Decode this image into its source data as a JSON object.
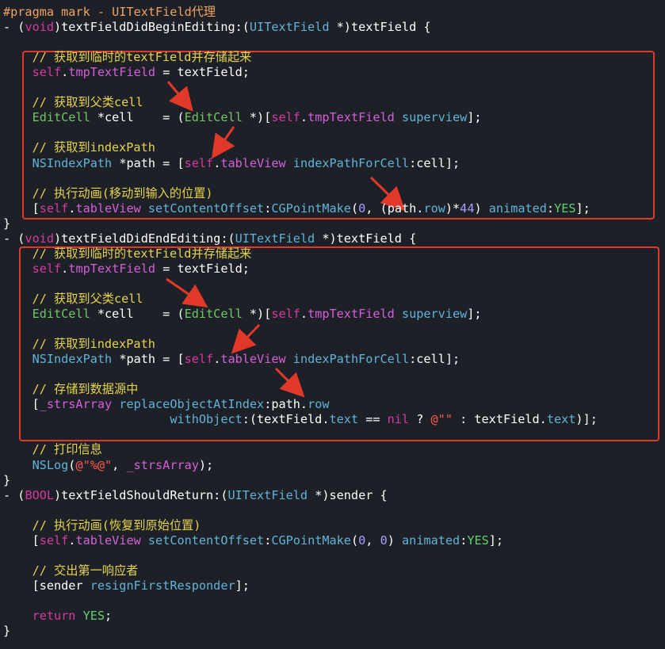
{
  "code_lines": [
    [
      {
        "t": "#pragma mark - UITextField代理",
        "c": "pragma"
      }
    ],
    [
      {
        "t": "- (",
        "c": "plain"
      },
      {
        "t": "void",
        "c": "kw"
      },
      {
        "t": ")textFieldDidBeginEditing:(",
        "c": "plain"
      },
      {
        "t": "UITextField",
        "c": "type"
      },
      {
        "t": " *)textField {",
        "c": "plain"
      }
    ],
    [],
    [
      {
        "t": "    // 获取到临时的textField并存储起来",
        "c": "comment"
      }
    ],
    [
      {
        "t": "    ",
        "c": "plain"
      },
      {
        "t": "self",
        "c": "self"
      },
      {
        "t": ".",
        "c": "plain"
      },
      {
        "t": "tmpTextField",
        "c": "prop"
      },
      {
        "t": " = textField;",
        "c": "plain"
      }
    ],
    [],
    [
      {
        "t": "    // 获取到父类cell",
        "c": "comment"
      }
    ],
    [
      {
        "t": "    ",
        "c": "plain"
      },
      {
        "t": "EditCell",
        "c": "class"
      },
      {
        "t": " *cell    = (",
        "c": "plain"
      },
      {
        "t": "EditCell",
        "c": "class"
      },
      {
        "t": " *)[",
        "c": "plain"
      },
      {
        "t": "self",
        "c": "self"
      },
      {
        "t": ".",
        "c": "plain"
      },
      {
        "t": "tmpTextField",
        "c": "prop"
      },
      {
        "t": " ",
        "c": "plain"
      },
      {
        "t": "superview",
        "c": "method"
      },
      {
        "t": "];",
        "c": "plain"
      }
    ],
    [],
    [
      {
        "t": "    // 获取到indexPath",
        "c": "comment"
      }
    ],
    [
      {
        "t": "    ",
        "c": "plain"
      },
      {
        "t": "NSIndexPath",
        "c": "type"
      },
      {
        "t": " *path = [",
        "c": "plain"
      },
      {
        "t": "self",
        "c": "self"
      },
      {
        "t": ".",
        "c": "plain"
      },
      {
        "t": "tableView",
        "c": "prop"
      },
      {
        "t": " ",
        "c": "plain"
      },
      {
        "t": "indexPathForCell",
        "c": "method"
      },
      {
        "t": ":cell];",
        "c": "plain"
      }
    ],
    [],
    [
      {
        "t": "    // 执行动画(移动到输入的位置)",
        "c": "comment"
      }
    ],
    [
      {
        "t": "    [",
        "c": "plain"
      },
      {
        "t": "self",
        "c": "self"
      },
      {
        "t": ".",
        "c": "plain"
      },
      {
        "t": "tableView",
        "c": "prop"
      },
      {
        "t": " ",
        "c": "plain"
      },
      {
        "t": "setContentOffset",
        "c": "method"
      },
      {
        "t": ":",
        "c": "plain"
      },
      {
        "t": "CGPointMake",
        "c": "method"
      },
      {
        "t": "(",
        "c": "plain"
      },
      {
        "t": "0",
        "c": "num"
      },
      {
        "t": ", (path.",
        "c": "plain"
      },
      {
        "t": "row",
        "c": "method"
      },
      {
        "t": ")*",
        "c": "plain"
      },
      {
        "t": "44",
        "c": "num"
      },
      {
        "t": ") ",
        "c": "plain"
      },
      {
        "t": "animated",
        "c": "method"
      },
      {
        "t": ":",
        "c": "plain"
      },
      {
        "t": "YES",
        "c": "kwg"
      },
      {
        "t": "];",
        "c": "plain"
      }
    ],
    [
      {
        "t": "}",
        "c": "plain"
      }
    ],
    [
      {
        "t": "- (",
        "c": "plain"
      },
      {
        "t": "void",
        "c": "kw"
      },
      {
        "t": ")textFieldDidEndEditing:(",
        "c": "plain"
      },
      {
        "t": "UITextField",
        "c": "type"
      },
      {
        "t": " *)textField {",
        "c": "plain"
      }
    ],
    [
      {
        "t": "    // 获取到临时的textField并存储起来",
        "c": "comment"
      }
    ],
    [
      {
        "t": "    ",
        "c": "plain"
      },
      {
        "t": "self",
        "c": "self"
      },
      {
        "t": ".",
        "c": "plain"
      },
      {
        "t": "tmpTextField",
        "c": "prop"
      },
      {
        "t": " = textField;",
        "c": "plain"
      }
    ],
    [],
    [
      {
        "t": "    // 获取到父类cell",
        "c": "comment"
      }
    ],
    [
      {
        "t": "    ",
        "c": "plain"
      },
      {
        "t": "EditCell",
        "c": "class"
      },
      {
        "t": " *cell    = (",
        "c": "plain"
      },
      {
        "t": "EditCell",
        "c": "class"
      },
      {
        "t": " *)[",
        "c": "plain"
      },
      {
        "t": "self",
        "c": "self"
      },
      {
        "t": ".",
        "c": "plain"
      },
      {
        "t": "tmpTextField",
        "c": "prop"
      },
      {
        "t": " ",
        "c": "plain"
      },
      {
        "t": "superview",
        "c": "method"
      },
      {
        "t": "];",
        "c": "plain"
      }
    ],
    [],
    [
      {
        "t": "    // 获取到indexPath",
        "c": "comment"
      }
    ],
    [
      {
        "t": "    ",
        "c": "plain"
      },
      {
        "t": "NSIndexPath",
        "c": "type"
      },
      {
        "t": " *path = [",
        "c": "plain"
      },
      {
        "t": "self",
        "c": "self"
      },
      {
        "t": ".",
        "c": "plain"
      },
      {
        "t": "tableView",
        "c": "prop"
      },
      {
        "t": " ",
        "c": "plain"
      },
      {
        "t": "indexPathForCell",
        "c": "method"
      },
      {
        "t": ":cell];",
        "c": "plain"
      }
    ],
    [],
    [
      {
        "t": "    // 存储到数据源中",
        "c": "comment"
      }
    ],
    [
      {
        "t": "    [",
        "c": "plain"
      },
      {
        "t": "_strsArray",
        "c": "prop"
      },
      {
        "t": " ",
        "c": "plain"
      },
      {
        "t": "replaceObjectAtIndex",
        "c": "method"
      },
      {
        "t": ":path.",
        "c": "plain"
      },
      {
        "t": "row",
        "c": "method"
      }
    ],
    [
      {
        "t": "                       ",
        "c": "plain"
      },
      {
        "t": "withObject",
        "c": "method"
      },
      {
        "t": ":(textField.",
        "c": "plain"
      },
      {
        "t": "text",
        "c": "method"
      },
      {
        "t": " == ",
        "c": "plain"
      },
      {
        "t": "nil",
        "c": "kw"
      },
      {
        "t": " ? ",
        "c": "plain"
      },
      {
        "t": "@\"\"",
        "c": "str"
      },
      {
        "t": " : textField.",
        "c": "plain"
      },
      {
        "t": "text",
        "c": "method"
      },
      {
        "t": ")];",
        "c": "plain"
      }
    ],
    [],
    [
      {
        "t": "    // 打印信息",
        "c": "comment"
      }
    ],
    [
      {
        "t": "    ",
        "c": "plain"
      },
      {
        "t": "NSLog",
        "c": "method"
      },
      {
        "t": "(",
        "c": "plain"
      },
      {
        "t": "@\"%@\"",
        "c": "str"
      },
      {
        "t": ", ",
        "c": "plain"
      },
      {
        "t": "_strsArray",
        "c": "prop"
      },
      {
        "t": ");",
        "c": "plain"
      }
    ],
    [
      {
        "t": "}",
        "c": "plain"
      }
    ],
    [
      {
        "t": "- (",
        "c": "plain"
      },
      {
        "t": "BOOL",
        "c": "kw"
      },
      {
        "t": ")textFieldShouldReturn:(",
        "c": "plain"
      },
      {
        "t": "UITextField",
        "c": "type"
      },
      {
        "t": " *)sender {",
        "c": "plain"
      }
    ],
    [],
    [
      {
        "t": "    // 执行动画(恢复到原始位置)",
        "c": "comment"
      }
    ],
    [
      {
        "t": "    [",
        "c": "plain"
      },
      {
        "t": "self",
        "c": "self"
      },
      {
        "t": ".",
        "c": "plain"
      },
      {
        "t": "tableView",
        "c": "prop"
      },
      {
        "t": " ",
        "c": "plain"
      },
      {
        "t": "setContentOffset",
        "c": "method"
      },
      {
        "t": ":",
        "c": "plain"
      },
      {
        "t": "CGPointMake",
        "c": "method"
      },
      {
        "t": "(",
        "c": "plain"
      },
      {
        "t": "0",
        "c": "num"
      },
      {
        "t": ", ",
        "c": "plain"
      },
      {
        "t": "0",
        "c": "num"
      },
      {
        "t": ") ",
        "c": "plain"
      },
      {
        "t": "animated",
        "c": "method"
      },
      {
        "t": ":",
        "c": "plain"
      },
      {
        "t": "YES",
        "c": "kwg"
      },
      {
        "t": "];",
        "c": "plain"
      }
    ],
    [],
    [
      {
        "t": "    // 交出第一响应者",
        "c": "comment"
      }
    ],
    [
      {
        "t": "    [sender ",
        "c": "plain"
      },
      {
        "t": "resignFirstResponder",
        "c": "method"
      },
      {
        "t": "];",
        "c": "plain"
      }
    ],
    [],
    [
      {
        "t": "    ",
        "c": "plain"
      },
      {
        "t": "return",
        "c": "kw"
      },
      {
        "t": " ",
        "c": "plain"
      },
      {
        "t": "YES",
        "c": "kwg"
      },
      {
        "t": ";",
        "c": "plain"
      }
    ],
    [
      {
        "t": "}",
        "c": "plain"
      }
    ]
  ],
  "colors": {
    "background": "#1e2028",
    "highlight_box": "#e0392a",
    "arrow": "#e0392a"
  }
}
